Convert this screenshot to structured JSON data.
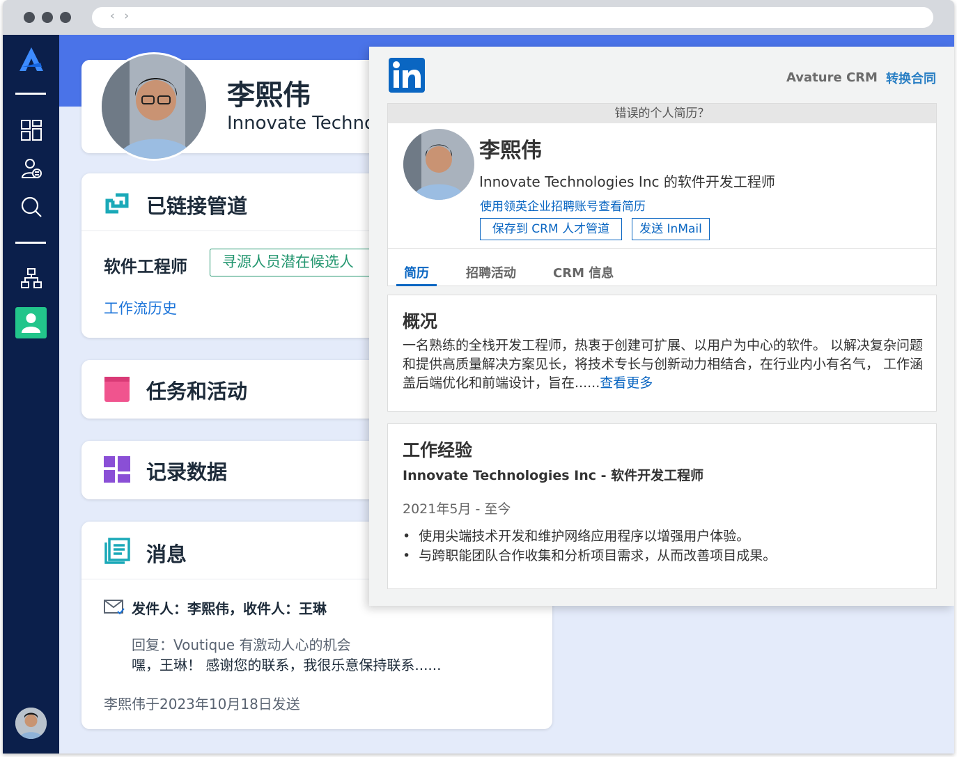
{
  "profile": {
    "name": "李熙伟",
    "company_truncated": "Innovate Technol"
  },
  "pipelines": {
    "title": "已链接管道",
    "job": "软件工程师",
    "stage_button": "寻源人员潜在候选人",
    "history_link": "工作流历史"
  },
  "tasks": {
    "title": "任务和活动"
  },
  "records": {
    "title": "记录数据"
  },
  "messages": {
    "title": "消息",
    "from_to": "发件人：李熙伟，收件人：王琳",
    "subject": "回复：Voutique 有激动人心的机会",
    "preview": "嘿，王琳！ 感谢您的联系，我很乐意保持联系......",
    "sent": "李熙伟于2023年10月18日发送"
  },
  "linkedin": {
    "crm_label": "Avature CRM",
    "convert_link": "转换合同",
    "wrong_profile": "错误的个人简历？",
    "name": "李熙伟",
    "headline": "Innovate Technologies Inc 的软件开发工程师",
    "recruiter_link": "使用领英企业招聘账号查看简历",
    "save_button": "保存到 CRM 人才管道",
    "inmail_button": "发送 InMail",
    "tabs": [
      "简历",
      "招聘活动",
      "CRM 信息"
    ],
    "summary_title": "概况",
    "summary_text": "一名熟练的全栈开发工程师，热衷于创建可扩展、以用户为中心的软件。 以解决复杂问题和提供高质量解决方案见长，将技术专长与创新动力相结合，在行业内小有名气， 工作涵盖后端优化和前端设计，旨在......",
    "see_more": "查看更多",
    "experience_title": "工作经验",
    "experience_role": "Innovate Technologies Inc - 软件开发工程师",
    "experience_dates": "2021年5月 - 至今",
    "experience_bullets": [
      "使用尖端技术开发和维护网络应用程序以增强用户体验。",
      "与跨职能团队合作收集和分析项目需求，从而改善项目成果。"
    ]
  },
  "icons": {
    "logo": "avature-logo-icon",
    "nav": [
      "dashboard-icon",
      "contacts-icon",
      "search-icon",
      "org-chart-icon",
      "person-icon"
    ],
    "pipelines": "link-icon",
    "tasks": "calendar-icon",
    "records": "grid-icon",
    "messages": "document-icon",
    "envelope": "envelope-icon",
    "linkedin": "linkedin-logo-icon"
  },
  "colors": {
    "sidebar": "#0b1f4b",
    "banner": "#4a73e8",
    "accent_green": "#22c58b",
    "teal": "#1aa9b8",
    "pink": "#f0548e",
    "purple": "#8a4fd6",
    "linkedin_blue": "#0a66c2"
  }
}
